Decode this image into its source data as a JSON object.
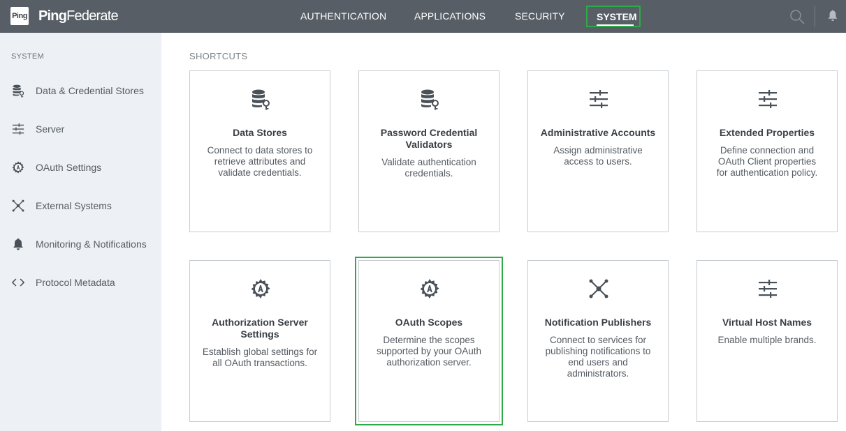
{
  "header": {
    "logo_box": "Ping",
    "logo_text_bold": "Ping",
    "logo_text_rest": "Federate",
    "nav": [
      "AUTHENTICATION",
      "APPLICATIONS",
      "SECURITY"
    ],
    "nav_active": "SYSTEM"
  },
  "sidebar": {
    "heading": "SYSTEM",
    "items": [
      {
        "label": "Data & Credential Stores",
        "icon": "database-key-icon"
      },
      {
        "label": "Server",
        "icon": "sliders-icon"
      },
      {
        "label": "OAuth Settings",
        "icon": "oauth-gear-icon"
      },
      {
        "label": "External Systems",
        "icon": "network-icon"
      },
      {
        "label": "Monitoring & Notifications",
        "icon": "bell-icon"
      },
      {
        "label": "Protocol Metadata",
        "icon": "code-brackets-icon"
      }
    ]
  },
  "main": {
    "section_title": "SHORTCUTS",
    "cards": [
      {
        "title": "Data Stores",
        "desc": "Connect to data stores to retrieve attributes and validate credentials.",
        "icon": "database-key-icon"
      },
      {
        "title": "Password Credential Validators",
        "desc": "Validate authentication credentials.",
        "icon": "database-key-icon"
      },
      {
        "title": "Administrative Accounts",
        "desc": "Assign administrative access to users.",
        "icon": "sliders-icon"
      },
      {
        "title": "Extended Properties",
        "desc": "Define connection and OAuth Client properties for authentication policy.",
        "icon": "sliders-icon"
      },
      {
        "title": "Authorization Server Settings",
        "desc": "Establish global settings for all OAuth transactions.",
        "icon": "oauth-gear-icon"
      },
      {
        "title": "OAuth Scopes",
        "desc": "Determine the scopes supported by your OAuth authorization server.",
        "icon": "oauth-gear-icon"
      },
      {
        "title": "Notification Publishers",
        "desc": "Connect to services for publishing notifications to end users and administrators.",
        "icon": "network-icon"
      },
      {
        "title": "Virtual Host Names",
        "desc": "Enable multiple brands.",
        "icon": "sliders-icon"
      }
    ]
  },
  "colors": {
    "header_bg": "#575e66",
    "sidebar_bg": "#edf1f5",
    "highlight": "#2eaa48",
    "icon": "#4a5058"
  }
}
